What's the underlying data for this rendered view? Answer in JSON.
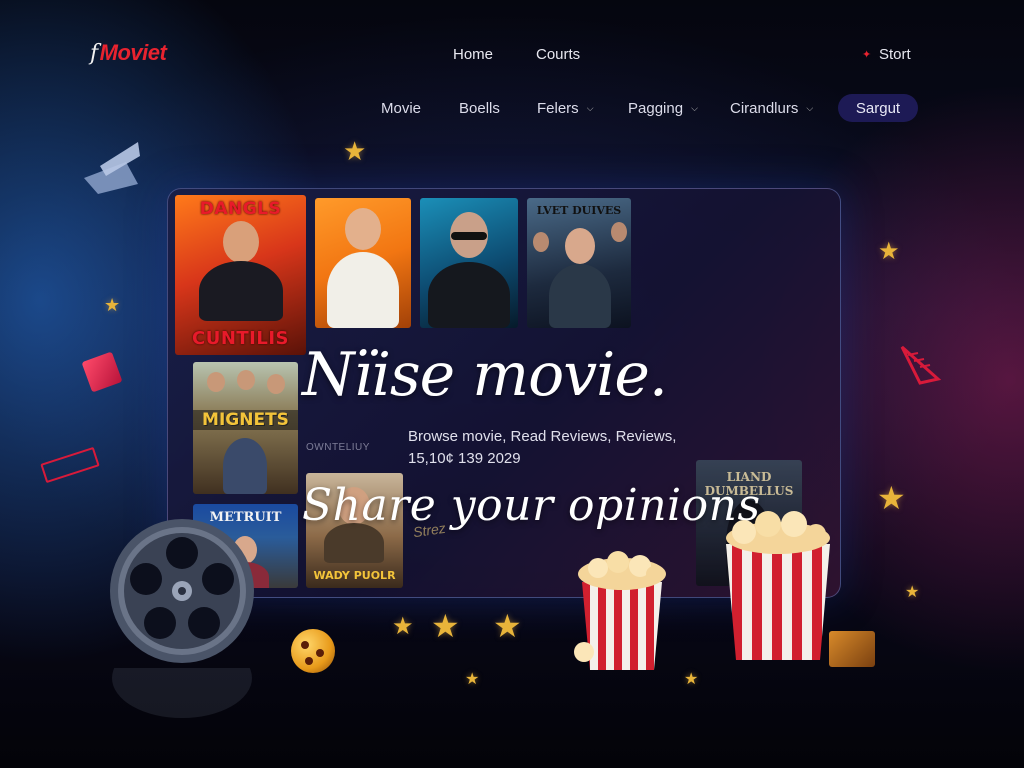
{
  "brand": {
    "logo_prefix": "f",
    "logo_text": "Moviet",
    "accent_color": "#e8232f"
  },
  "topnav": {
    "home": "Home",
    "courts": "Courts",
    "start": "Stort"
  },
  "subnav": {
    "movie": "Movie",
    "boells": "Boells",
    "felers": "Felers",
    "pagging": "Pagging",
    "cirandlurs": "Cirandlurs",
    "search": "Sargut"
  },
  "hero": {
    "title": "Nïise movie.",
    "description": "Browse movie, Read Reviews, Reviews,",
    "date_line": "15,10¢ 139 2029",
    "subtitle": "Share your opinions"
  },
  "posters": [
    {
      "top_title": "DANGLS",
      "bottom_title": "CUNTILIS"
    },
    {
      "title": ""
    },
    {
      "caption": ""
    },
    {
      "title": "LVET DUIVES"
    },
    {
      "title": "MIGNETS"
    },
    {
      "title": "METRUIT"
    },
    {
      "title": "WADY PUOLR"
    },
    {
      "title": "LIAND DUMBELLUS"
    }
  ],
  "background_labels": {
    "left": "OWNTELIUY",
    "script": "Strez"
  },
  "icons": {
    "start": "sparkle-icon",
    "reel": "film-reel-icon",
    "popcorn": "popcorn-icon",
    "star": "star-icon",
    "ball": "ball-icon",
    "clapper": "clapperboard-icon",
    "ticket": "ticket-icon"
  }
}
